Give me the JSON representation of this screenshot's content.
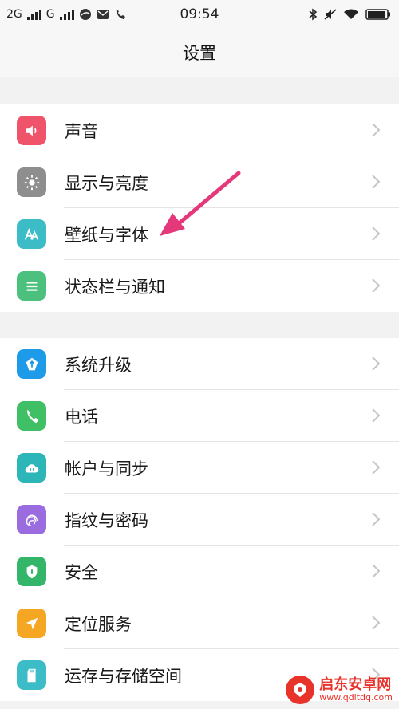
{
  "status_bar": {
    "net1": "2G",
    "net2": "G",
    "time": "09:54"
  },
  "header": {
    "title": "设置"
  },
  "groups": [
    {
      "items": [
        {
          "label": "声音",
          "icon": "speaker-icon",
          "color": "#f0546b"
        },
        {
          "label": "显示与亮度",
          "icon": "brightness-icon",
          "color": "#8e8e8e"
        },
        {
          "label": "壁纸与字体",
          "icon": "font-icon",
          "color": "#3cbcc7"
        },
        {
          "label": "状态栏与通知",
          "icon": "list-icon",
          "color": "#4cc17e"
        }
      ]
    },
    {
      "items": [
        {
          "label": "系统升级",
          "icon": "upgrade-icon",
          "color": "#1e9be8"
        },
        {
          "label": "电话",
          "icon": "phone-icon",
          "color": "#3fc065"
        },
        {
          "label": "帐户与同步",
          "icon": "cloud-sync-icon",
          "color": "#2db6b8"
        },
        {
          "label": "指纹与密码",
          "icon": "fingerprint-icon",
          "color": "#9a6ce0"
        },
        {
          "label": "安全",
          "icon": "shield-icon",
          "color": "#33b56a"
        },
        {
          "label": "定位服务",
          "icon": "location-icon",
          "color": "#f5a623"
        },
        {
          "label": "运存与存储空间",
          "icon": "sd-card-icon",
          "color": "#3cbcc7"
        }
      ]
    }
  ],
  "annotation": {
    "arrow_color": "#e5387a"
  },
  "watermark": {
    "title": "启东安卓网",
    "url": "www.qdltdq.com"
  }
}
